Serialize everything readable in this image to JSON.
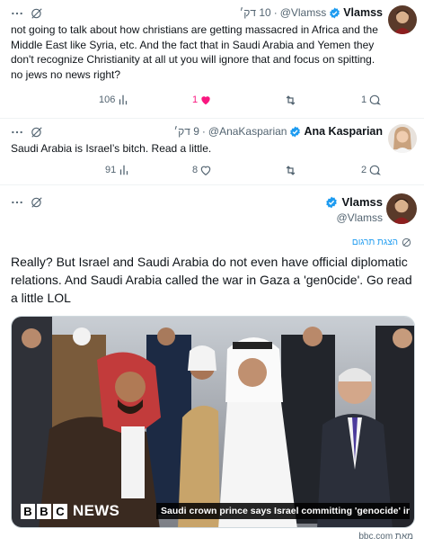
{
  "tweets": [
    {
      "name": "Vlamss",
      "handle": "@Vlamss",
      "time": "10 דק׳",
      "text": "not going to talk about how christians are getting massacred in Africa and the Middle East like Syria, etc. And the fact that in Saudi Arabia and Yemen they don't recognize Christianity at all  ut you will ignore that and focus on spitting. no jews no news right?",
      "replies": "1",
      "retweets": "",
      "likes": "1",
      "views": "106",
      "liked": true
    },
    {
      "name": "Ana Kasparian",
      "handle": "@AnaKasparian",
      "time": "9 דק׳",
      "text": "Saudi Arabia is Israel’s bitch. Read a little.",
      "replies": "2",
      "retweets": "",
      "likes": "8",
      "views": "91",
      "liked": false
    }
  ],
  "main_tweet": {
    "name": "Vlamss",
    "handle": "@Vlamss",
    "translate_label": "הצגת תרגום",
    "text": "Really? But Israel and Saudi Arabia do not even have official diplomatic relations. And Saudi Arabia called the war in Gaza a 'gen0cide'. Go read a little LOL",
    "media": {
      "logo_letters": [
        "B",
        "B",
        "C"
      ],
      "logo_word": "NEWS",
      "caption": "Saudi crown prince says Israel committing 'genocide' in Gaza"
    },
    "source": "מאת bbc.com"
  },
  "separator": "·",
  "colors": {
    "text": "#0f1419",
    "secondary": "#536471",
    "accent": "#1d9bf0",
    "like": "#f91880",
    "border": "#eff3f4"
  },
  "icons": [
    "verified-badge-icon",
    "more-icon",
    "grok-icon",
    "reply-icon",
    "retweet-icon",
    "like-icon",
    "views-icon",
    "translate-icon"
  ]
}
